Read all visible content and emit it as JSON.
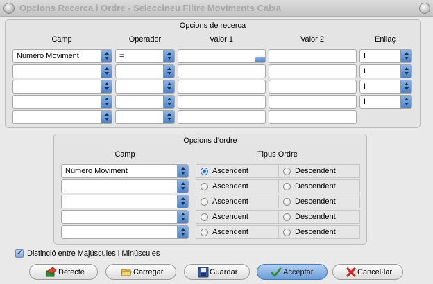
{
  "window": {
    "title": "Opcions Recerca i Ordre - Seleccineu Filtre Moviments Caixa"
  },
  "search": {
    "title": "Opcions de recerca",
    "headers": {
      "camp": "Camp",
      "operador": "Operador",
      "valor1": "Valor 1",
      "valor2": "Valor 2",
      "enllac": "Enllaç"
    },
    "rows": [
      {
        "camp": "Número Moviment",
        "operador": "=",
        "valor1": "",
        "valor2": "",
        "enllac": "I"
      },
      {
        "camp": "",
        "operador": "",
        "valor1": "",
        "valor2": "",
        "enllac": "I"
      },
      {
        "camp": "",
        "operador": "",
        "valor1": "",
        "valor2": "",
        "enllac": "I"
      },
      {
        "camp": "",
        "operador": "",
        "valor1": "",
        "valor2": "",
        "enllac": "I"
      },
      {
        "camp": "",
        "operador": "",
        "valor1": "",
        "valor2": ""
      }
    ]
  },
  "order": {
    "title": "Opcions d'ordre",
    "headers": {
      "camp": "Camp",
      "tipus": "Tipus Ordre"
    },
    "asc_label": "Ascendent",
    "desc_label": "Descendent",
    "rows": [
      {
        "camp": "Número Moviment",
        "selected": "asc"
      },
      {
        "camp": "",
        "selected": "none"
      },
      {
        "camp": "",
        "selected": "none"
      },
      {
        "camp": "",
        "selected": "none"
      },
      {
        "camp": "",
        "selected": "none"
      }
    ]
  },
  "case_checkbox": {
    "label": "Distinció entre Majúscules i Minúscules",
    "checked": true
  },
  "buttons": {
    "defecte": "Defecte",
    "carregar": "Carregar",
    "guardar": "Guardar",
    "acceptar": "Acceptar",
    "cancelar": "Cancel·lar"
  },
  "colors": {
    "accent": "#4f82c6",
    "primary_button": "#6a9bd8"
  }
}
